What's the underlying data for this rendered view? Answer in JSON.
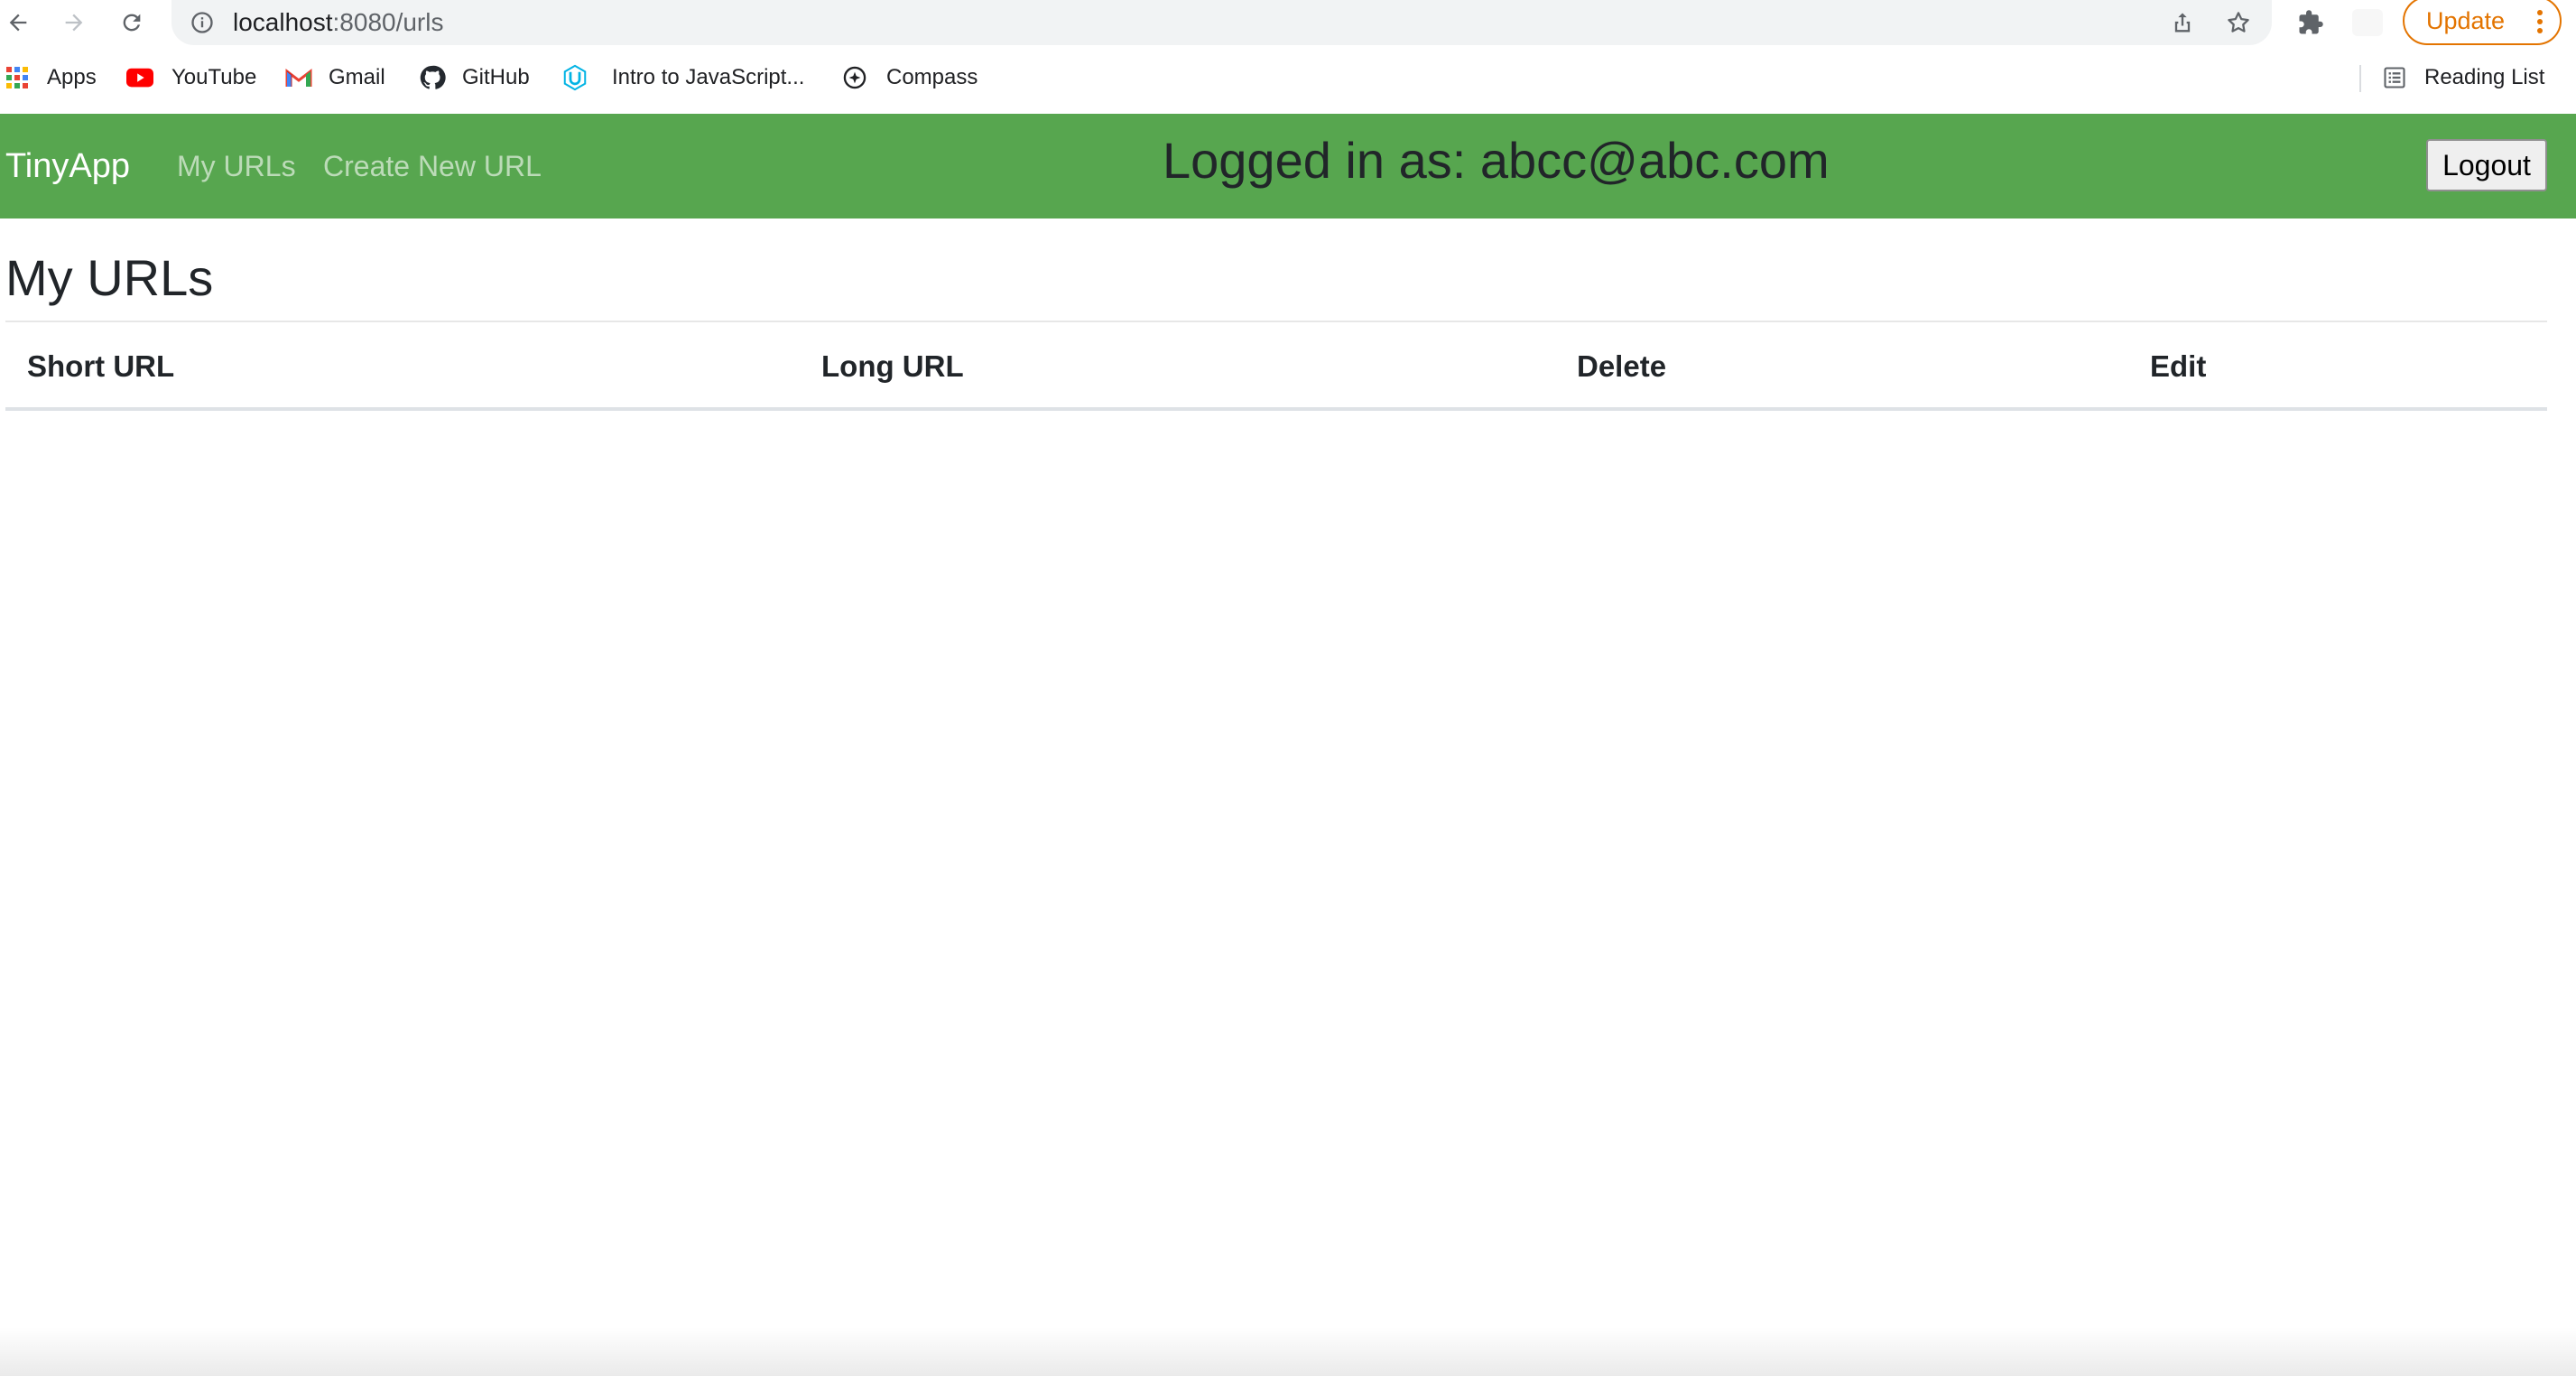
{
  "browser": {
    "url_host": "localhost",
    "url_path": ":8080/urls",
    "update_label": "Update",
    "bookmarks": [
      {
        "label": "Apps",
        "icon": "apps-grid-icon"
      },
      {
        "label": "YouTube",
        "icon": "youtube-icon"
      },
      {
        "label": "Gmail",
        "icon": "gmail-icon"
      },
      {
        "label": "GitHub",
        "icon": "github-icon"
      },
      {
        "label": "Intro to JavaScript...",
        "icon": "udacity-icon"
      },
      {
        "label": "Compass",
        "icon": "compass-icon"
      }
    ],
    "reading_list_label": "Reading List"
  },
  "navbar": {
    "brand": "TinyApp",
    "links": [
      "My URLs",
      "Create New URL"
    ],
    "logged_in_text": "Logged in as: abcc@abc.com",
    "logout_label": "Logout",
    "background_color": "#57a64f"
  },
  "main": {
    "title": "My URLs",
    "table": {
      "columns": [
        "Short URL",
        "Long URL",
        "Delete",
        "Edit"
      ],
      "rows": []
    }
  }
}
